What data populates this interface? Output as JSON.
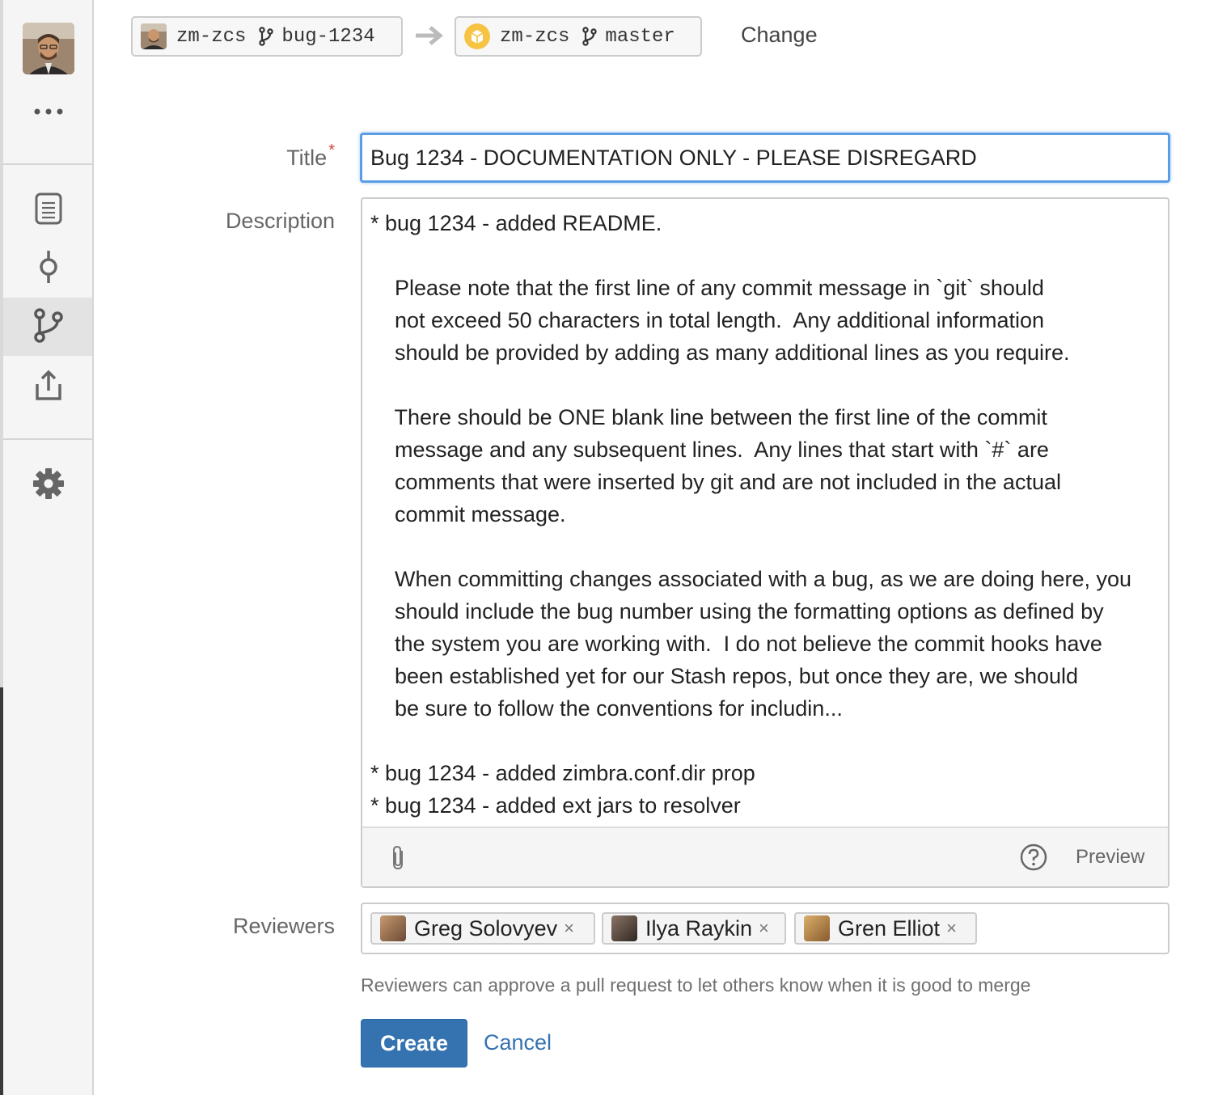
{
  "source": {
    "repo": "zm-zcs",
    "branch": "bug-1234"
  },
  "target": {
    "repo": "zm-zcs",
    "branch": "master"
  },
  "change_label": "Change",
  "form": {
    "title_label": "Title",
    "title_required_mark": "*",
    "title_value": "Bug 1234 - DOCUMENTATION ONLY - PLEASE DISREGARD",
    "description_label": "Description",
    "description_value": "* bug 1234 - added README.\n\n    Please note that the first line of any commit message in `git` should\n    not exceed 50 characters in total length.  Any additional information\n    should be provided by adding as many additional lines as you require.\n\n    There should be ONE blank line between the first line of the commit\n    message and any subsequent lines.  Any lines that start with `#` are\n    comments that were inserted by git and are not included in the actual\n    commit message.\n\n    When committing changes associated with a bug, as we are doing here, you\n    should include the bug number using the formatting options as defined by\n    the system you are working with.  I do not believe the commit hooks have\n    been established yet for our Stash repos, but once they are, we should\n    be sure to follow the conventions for includin...\n\n* bug 1234 - added zimbra.conf.dir prop\n* bug 1234 - added ext jars to resolver",
    "preview_label": "Preview",
    "reviewers_label": "Reviewers",
    "reviewers": [
      {
        "name": "Greg Solovyev",
        "remove": "×"
      },
      {
        "name": "Ilya Raykin",
        "remove": "×"
      },
      {
        "name": "Gren Elliot",
        "remove": "×"
      }
    ],
    "reviewers_hint": "Reviewers can approve a pull request to let others know when it is good to merge",
    "create_label": "Create",
    "cancel_label": "Cancel"
  },
  "sidebar": {
    "items": [
      {
        "icon": "source-icon"
      },
      {
        "icon": "commits-icon"
      },
      {
        "icon": "branches-icon",
        "active": true
      },
      {
        "icon": "pull-requests-icon"
      },
      {
        "icon": "settings-icon"
      }
    ]
  },
  "colors": {
    "accent": "#3572b0",
    "focus": "#5b9de4",
    "required": "#d04437"
  }
}
